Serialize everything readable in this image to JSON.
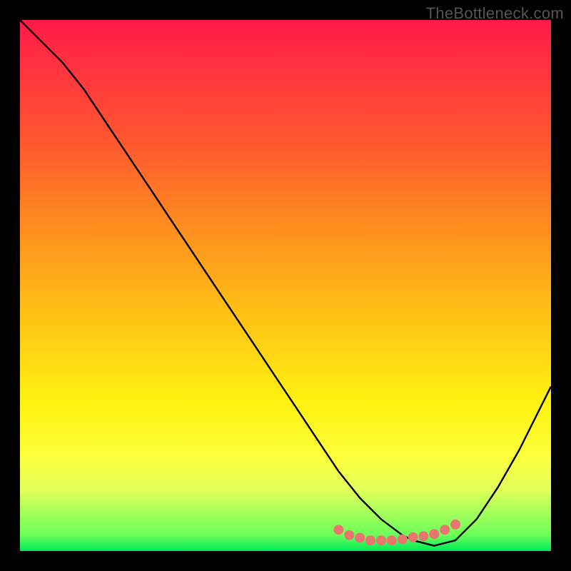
{
  "watermark": "TheBottleneck.com",
  "chart_data": {
    "type": "line",
    "title": "",
    "xlabel": "",
    "ylabel": "",
    "xlim": [
      0,
      100
    ],
    "ylim": [
      0,
      100
    ],
    "grid": false,
    "legend": false,
    "series": [
      {
        "name": "curve",
        "color": "#000000",
        "x": [
          0,
          4,
          8,
          12,
          16,
          20,
          24,
          28,
          32,
          36,
          40,
          44,
          48,
          52,
          56,
          60,
          64,
          68,
          72,
          74,
          78,
          82,
          86,
          90,
          94,
          98,
          100
        ],
        "y": [
          100,
          96,
          92,
          87,
          81,
          75,
          69,
          63,
          57,
          51,
          45,
          39,
          33,
          27,
          21,
          15,
          10,
          6,
          3,
          2,
          1,
          2,
          6,
          12,
          19,
          27,
          31
        ]
      },
      {
        "name": "highlight-dots",
        "color": "#e8766f",
        "marker": "dot",
        "x": [
          60,
          62,
          64,
          66,
          68,
          70,
          72,
          74,
          76,
          78,
          80,
          82
        ],
        "y": [
          4,
          3,
          2.5,
          2,
          2,
          2,
          2.2,
          2.6,
          2.8,
          3.2,
          4,
          5
        ]
      }
    ]
  }
}
